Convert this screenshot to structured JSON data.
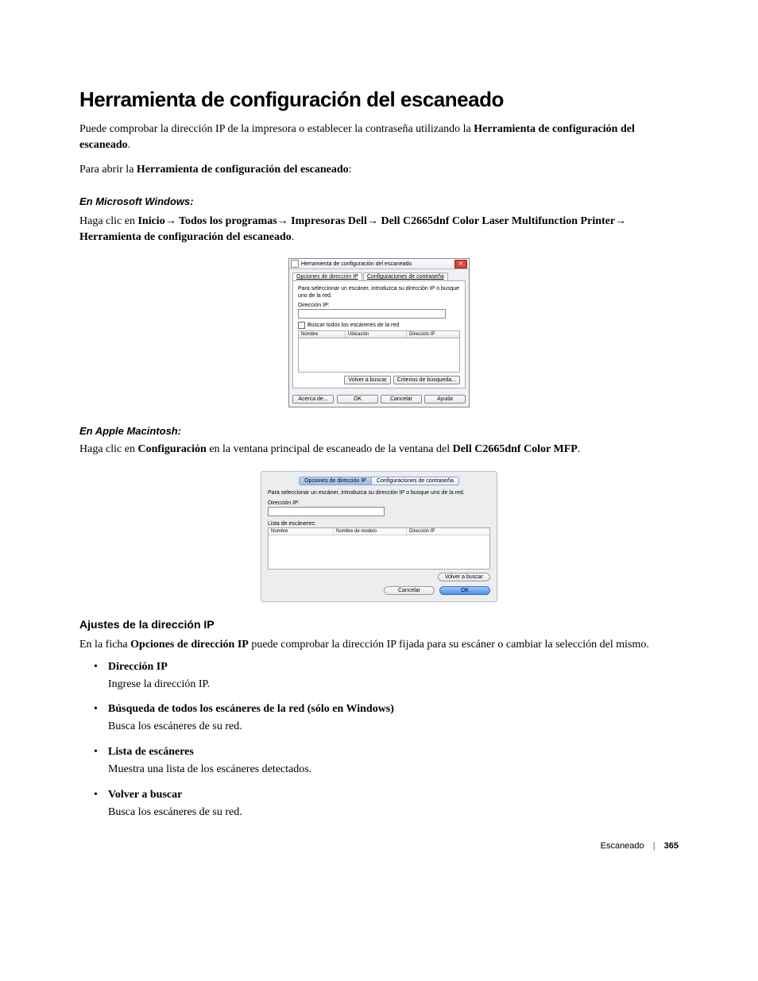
{
  "heading": "Herramienta de configuración del escaneado",
  "intro_prefix": "Puede comprobar la dirección IP de la impresora o establecer la contraseña utilizando la ",
  "intro_bold": "Herramienta de configuración del escaneado",
  "intro_suffix": ".",
  "intro2_prefix": "Para abrir la ",
  "intro2_bold": "Herramienta de configuración del escaneado",
  "intro2_suffix": ":",
  "win_heading": "En Microsoft Windows:",
  "win_instr": {
    "prefix": "Haga clic en ",
    "inicio": "Inicio",
    "arrow": "→",
    "todos": " Todos los programas",
    "impresoras": " Impresoras Dell",
    "device": " Dell C2665dnf Color Laser Multifunction Printer",
    "tool": " Herramienta de configuración del escaneado",
    "suffix": "."
  },
  "win_dialog": {
    "title": "Herramienta de configuración del escaneado",
    "tab_ip": "Opciones de dirección IP",
    "tab_pw": "Configuraciones de contraseña",
    "desc": "Para seleccionar un escáner, introduzca su dirección IP o busque uno de la red.",
    "lbl_ip": "Dirección IP:",
    "chk_label": "Buscar todos los escáneres de la red",
    "col1": "Nombre",
    "col2": "Ubicación",
    "col3": "Dirección IP",
    "btn_rescan": "Volver a buscar",
    "btn_criteria": "Criterios de búsqueda...",
    "btn_about": "Acerca de...",
    "btn_ok": "OK",
    "btn_cancel": "Cancelar",
    "btn_help": "Ayuda"
  },
  "mac_heading": "En Apple Macintosh:",
  "mac_instr": {
    "prefix": "Haga clic en ",
    "config": "Configuración",
    "mid": " en la ventana principal de escaneado de la ventana del ",
    "device": "Dell C2665dnf Color MFP",
    "suffix": "."
  },
  "mac_dialog": {
    "tab_ip": "Opciones de dirección IP",
    "tab_pw": "Configuraciones de contraseña",
    "desc": "Para seleccionar un escáner, introduzca su dirección IP o busque uno de la red.",
    "lbl_ip": "Dirección IP:",
    "lbl_list": "Lista de escáneres:",
    "col1": "Nombre",
    "col2": "Nombre de modelo",
    "col3": "Dirección IP",
    "btn_rescan": "Volver a buscar",
    "btn_cancel": "Cancelar",
    "btn_ok": "OK"
  },
  "ip_settings": {
    "heading": "Ajustes de la dirección IP",
    "intro_prefix": "En la ficha ",
    "intro_bold": "Opciones de dirección IP",
    "intro_suffix": " puede comprobar la dirección IP fijada para su escáner o cambiar la selección del mismo.",
    "items": [
      {
        "title": "Dirección IP",
        "note": "",
        "desc": "Ingrese la dirección IP."
      },
      {
        "title": "Búsqueda de todos los escáneres de la red",
        "note": " (sólo en Windows)",
        "desc": "Busca los escáneres de su red."
      },
      {
        "title": "Lista de escáneres",
        "note": "",
        "desc": "Muestra una lista de los escáneres detectados."
      },
      {
        "title": "Volver a buscar",
        "note": "",
        "desc": "Busca los escáneres de su red."
      }
    ]
  },
  "footer_label": "Escaneado",
  "footer_page": "365"
}
